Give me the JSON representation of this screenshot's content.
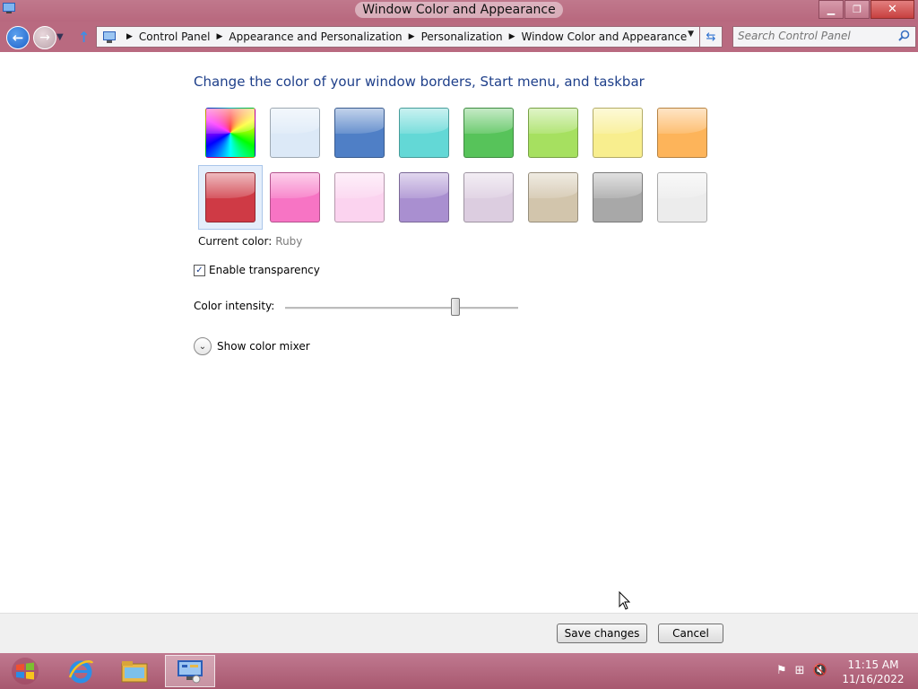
{
  "window": {
    "title": "Window Color and Appearance",
    "minimize_glyph": "▁",
    "maximize_glyph": "❐",
    "close_glyph": "✕"
  },
  "addressbar": {
    "back_glyph": "←",
    "forward_glyph": "→",
    "history_glyph": "▼",
    "up_glyph": "↑",
    "separator_glyph": "▶",
    "crumbs": [
      "Control Panel",
      "Appearance and Personalization",
      "Personalization",
      "Window Color and Appearance"
    ],
    "dropdown_glyph": "▼",
    "refresh_glyph": "⇆",
    "search_placeholder": "Search Control Panel"
  },
  "main": {
    "heading": "Change the color of your window borders, Start menu, and taskbar",
    "swatches": [
      {
        "name": "rainbow",
        "color": "conic"
      },
      {
        "name": "sky",
        "color": "#dce9f7"
      },
      {
        "name": "twilight",
        "color": "#4f7fc6"
      },
      {
        "name": "sea",
        "color": "#63d8d6"
      },
      {
        "name": "leaf",
        "color": "#57c35a"
      },
      {
        "name": "lime",
        "color": "#a6e060"
      },
      {
        "name": "sun",
        "color": "#f8ee8e"
      },
      {
        "name": "pumpkin",
        "color": "#fdb45a"
      },
      {
        "name": "ruby",
        "color": "#cf3a45"
      },
      {
        "name": "fuchsia",
        "color": "#f774c4"
      },
      {
        "name": "blush",
        "color": "#fbd3ef"
      },
      {
        "name": "violet",
        "color": "#a98fd0"
      },
      {
        "name": "lavender",
        "color": "#dccde0"
      },
      {
        "name": "taupe",
        "color": "#d2c5ac"
      },
      {
        "name": "chocolate",
        "color": "#a8a8a8"
      },
      {
        "name": "slate",
        "color": "#ececec"
      }
    ],
    "selected_swatch": "ruby",
    "current_color_label": "Current color:",
    "current_color_value": "Ruby",
    "transparency_label": "Enable transparency",
    "transparency_checked": true,
    "check_glyph": "✓",
    "intensity_label": "Color intensity:",
    "intensity_level": 0.73,
    "mixer_label": "Show color mixer",
    "mixer_glyph": "⌄"
  },
  "footer": {
    "save_label": "Save changes",
    "cancel_label": "Cancel"
  },
  "taskbar": {
    "start_icon": "windows-logo-icon",
    "pinned": [
      {
        "name": "internet-explorer-icon"
      },
      {
        "name": "file-explorer-icon"
      },
      {
        "name": "control-panel-icon",
        "active": true
      }
    ],
    "tray_icons": [
      "flag-icon",
      "network-icon",
      "volume-muted-icon"
    ],
    "tray_glyphs": [
      "⚑",
      "⊞",
      "🔇"
    ],
    "time": "11:15 AM",
    "date": "11/16/2022"
  },
  "colors": {
    "accent": "#b96a80",
    "heading": "#1e3f8a"
  }
}
